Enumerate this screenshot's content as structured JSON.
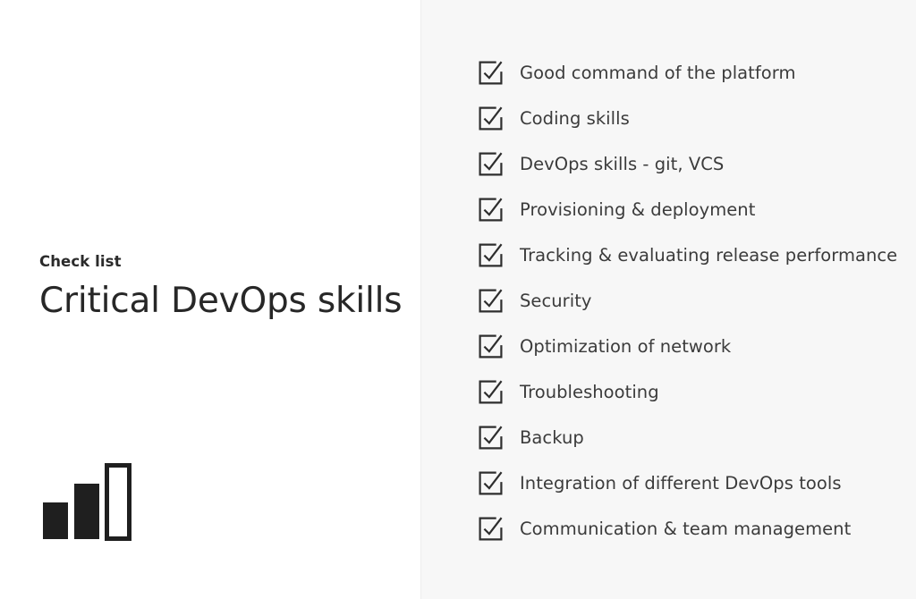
{
  "slide": {
    "background_left": "#ffffff",
    "background_right": "#f7f7f7",
    "divider_color": "#ededed"
  },
  "left": {
    "eyebrow": "Check list",
    "headline": "Critical DevOps skills",
    "icon": {
      "name": "bar-chart-icon",
      "bars": [
        {
          "height_ratio": 0.43,
          "filled": true
        },
        {
          "height_ratio": 0.66,
          "filled": true
        },
        {
          "height_ratio": 0.89,
          "filled": false
        }
      ],
      "fill_color": "#1f1f1f",
      "stroke_color": "#1f1f1f"
    }
  },
  "checklist": {
    "icon_name": "checkbox-checked-icon",
    "stroke_color": "#2e2e2e",
    "items": [
      {
        "label": "Good command of the platform",
        "checked": true
      },
      {
        "label": "Coding skills",
        "checked": true
      },
      {
        "label": "DevOps skills - git, VCS",
        "checked": true
      },
      {
        "label": "Provisioning & deployment",
        "checked": true
      },
      {
        "label": "Tracking & evaluating release performance",
        "checked": true
      },
      {
        "label": "Security",
        "checked": true
      },
      {
        "label": "Optimization of network",
        "checked": true
      },
      {
        "label": "Troubleshooting",
        "checked": true
      },
      {
        "label": "Backup",
        "checked": true
      },
      {
        "label": "Integration of different DevOps tools",
        "checked": true
      },
      {
        "label": "Communication & team management",
        "checked": true
      }
    ]
  }
}
